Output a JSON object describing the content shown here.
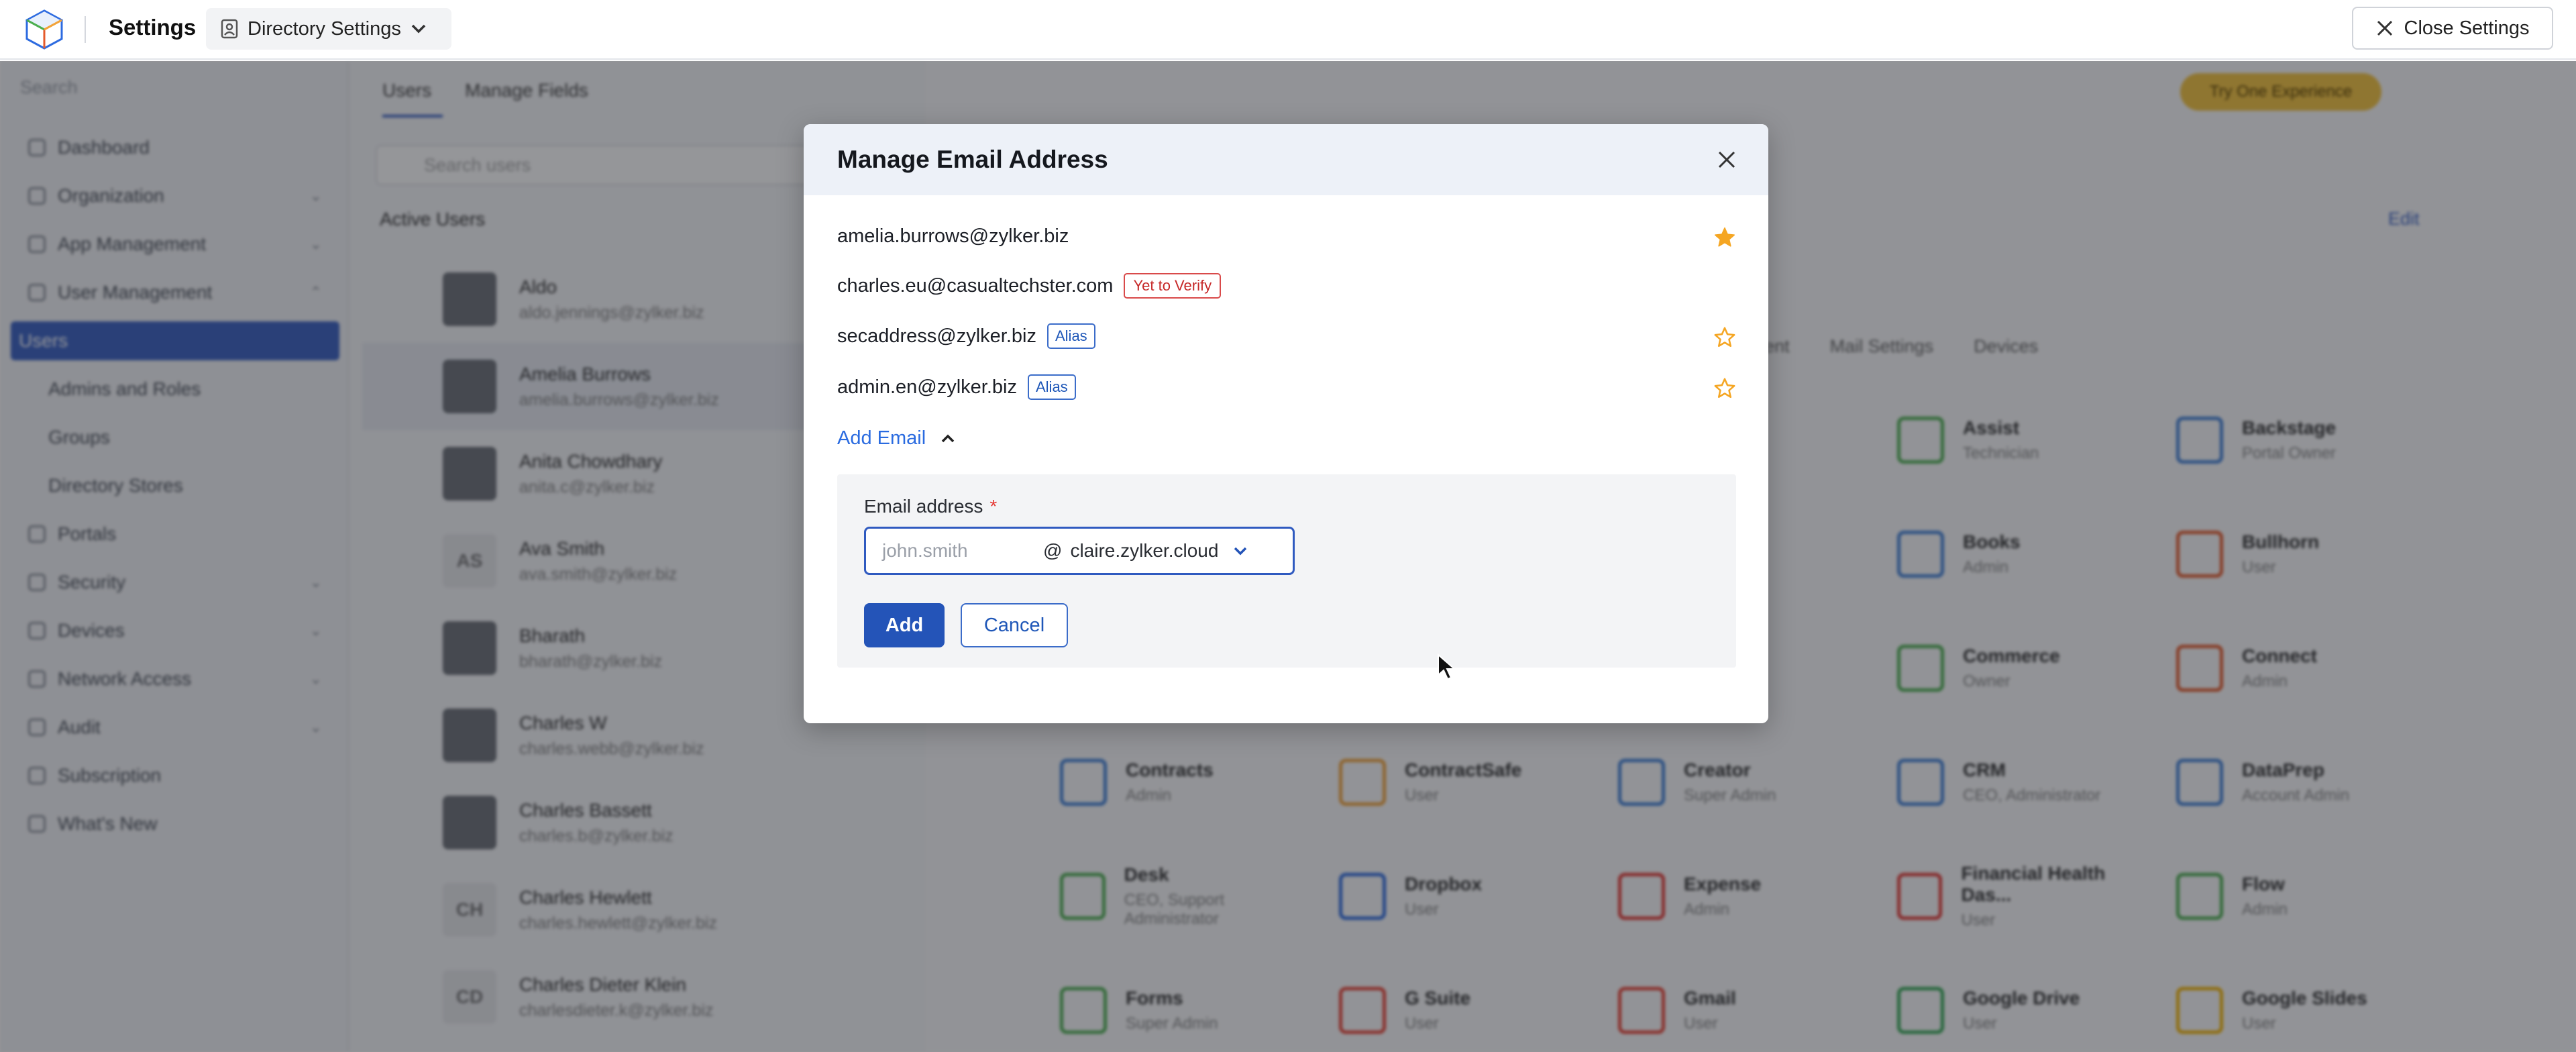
{
  "topbar": {
    "title": "Settings",
    "directory_label": "Directory Settings",
    "close_label": "Close Settings"
  },
  "background": {
    "search_placeholder": "Search",
    "nav": [
      {
        "label": "Dashboard"
      },
      {
        "label": "Organization"
      },
      {
        "label": "App Management"
      },
      {
        "label": "User Management"
      },
      {
        "label": "Users"
      },
      {
        "label": "Admins and Roles"
      },
      {
        "label": "Groups"
      },
      {
        "label": "Directory Stores"
      },
      {
        "label": "Portals"
      },
      {
        "label": "Security"
      },
      {
        "label": "Devices"
      },
      {
        "label": "Network Access"
      },
      {
        "label": "Audit"
      },
      {
        "label": "Subscription"
      },
      {
        "label": "What's New"
      }
    ],
    "tabs": [
      "Users",
      "Manage Fields"
    ],
    "search_users_placeholder": "Search users",
    "active_users_label": "Active Users",
    "users": [
      {
        "name": "Aldo",
        "email": "aldo.jennings@zylker.biz",
        "initials": ""
      },
      {
        "name": "Amelia Burrows",
        "email": "amelia.burrows@zylker.biz",
        "initials": ""
      },
      {
        "name": "Anita Chowdhary",
        "email": "anita.c@zylker.biz",
        "initials": ""
      },
      {
        "name": "Ava Smith",
        "email": "ava.smith@zylker.biz",
        "initials": "AS"
      },
      {
        "name": "Bharath",
        "email": "bharath@zylker.biz",
        "initials": ""
      },
      {
        "name": "Charles W",
        "email": "charles.webb@zylker.biz",
        "initials": ""
      },
      {
        "name": "Charles Bassett",
        "email": "charles.b@zylker.biz",
        "initials": ""
      },
      {
        "name": "Charles Hewlett",
        "email": "charles.hewlett@zylker.biz",
        "initials": "CH"
      },
      {
        "name": "Charles Dieter Klein",
        "email": "charlesdieter.k@zylker.biz",
        "initials": "CD"
      }
    ],
    "trial_label": "Try One Experience",
    "detail_tabs": [
      "Management",
      "Mail Settings",
      "Devices"
    ],
    "edit_label": "Edit",
    "apps": [
      {
        "name": "Assist",
        "role": "Technician",
        "color": "#4caf50"
      },
      {
        "name": "Backstage",
        "role": "Portal Owner",
        "color": "#3f7fd6"
      },
      {
        "name": "Books",
        "role": "Admin",
        "color": "#3f7fd6"
      },
      {
        "name": "Bullhorn",
        "role": "User",
        "color": "#e55a2b"
      },
      {
        "name": "Commerce",
        "role": "Owner",
        "color": "#4caf50"
      },
      {
        "name": "Connect",
        "role": "Admin",
        "color": "#e55a2b"
      },
      {
        "name": "Contracts",
        "role": "Admin",
        "color": "#3f7fd6"
      },
      {
        "name": "ContractSafe",
        "role": "User",
        "color": "#f2a33a"
      },
      {
        "name": "Creator",
        "role": "Super Admin",
        "color": "#3f7fd6"
      },
      {
        "name": "CRM",
        "role": "CEO, Administrator",
        "color": "#3f7fd6"
      },
      {
        "name": "DataPrep",
        "role": "Account Admin",
        "color": "#3f7fd6"
      },
      {
        "name": "Desk",
        "role": "CEO, Support Administrator",
        "color": "#4caf50"
      },
      {
        "name": "Dropbox",
        "role": "User",
        "color": "#2d6be0"
      },
      {
        "name": "Expense",
        "role": "Admin",
        "color": "#e53935"
      },
      {
        "name": "Financial Health Das...",
        "role": "User",
        "color": "#e53935"
      },
      {
        "name": "Flow",
        "role": "Admin",
        "color": "#4caf50"
      },
      {
        "name": "Forms",
        "role": "Super Admin",
        "color": "#4caf50"
      },
      {
        "name": "G Suite",
        "role": "User",
        "color": "#ea4335"
      },
      {
        "name": "Gmail",
        "role": "User",
        "color": "#ea4335"
      },
      {
        "name": "Google Drive",
        "role": "User",
        "color": "#34a853"
      },
      {
        "name": "Google Slides",
        "role": "User",
        "color": "#f4b400"
      }
    ]
  },
  "modal": {
    "title": "Manage Email Address",
    "emails": [
      {
        "address": "amelia.burrows@zylker.biz",
        "badge": "",
        "badge_type": "",
        "star": "filled"
      },
      {
        "address": "charles.eu@casualtechster.com",
        "badge": "Yet to Verify",
        "badge_type": "verify",
        "star": "none"
      },
      {
        "address": "secaddress@zylker.biz",
        "badge": "Alias",
        "badge_type": "alias",
        "star": "outline"
      },
      {
        "address": "admin.en@zylker.biz",
        "badge": "Alias",
        "badge_type": "alias",
        "star": "outline"
      }
    ],
    "add_email_link": "Add Email",
    "field_label": "Email address",
    "required_mark": "*",
    "input_placeholder": "john.smith",
    "at_sign": "@",
    "domain": "claire.zylker.cloud",
    "add_label": "Add",
    "cancel_label": "Cancel"
  },
  "colors": {
    "accent": "#2454b8",
    "link": "#2a6be0",
    "star": "#f5a623",
    "verify": "#d94a4a",
    "alias": "#3b6cc9"
  }
}
